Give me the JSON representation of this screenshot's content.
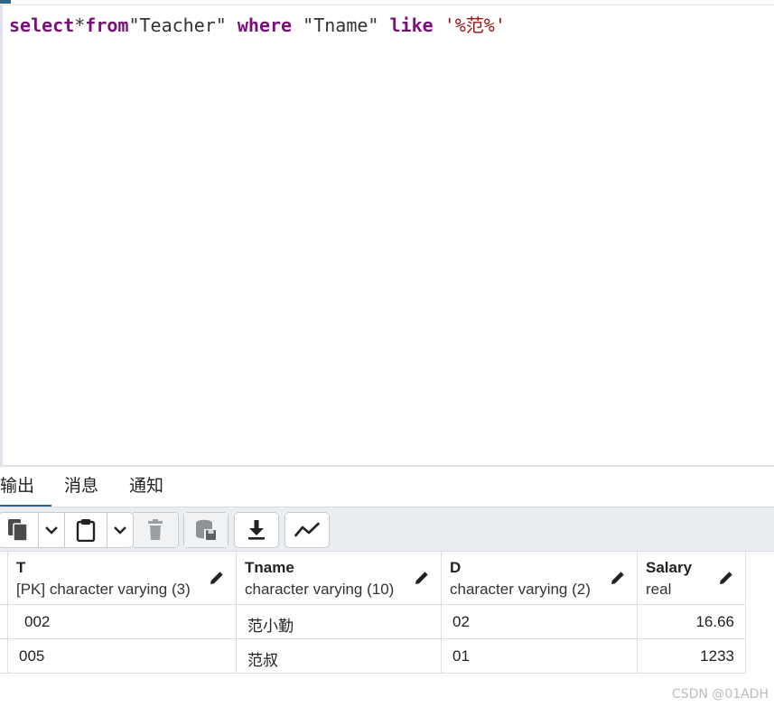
{
  "editor": {
    "query_tokens": [
      {
        "cls": "kw",
        "text": "select"
      },
      {
        "cls": "plain",
        "text": "*"
      },
      {
        "cls": "kw",
        "text": "from"
      },
      {
        "cls": "plain",
        "text": "\"Teacher\" "
      },
      {
        "cls": "kw",
        "text": "where"
      },
      {
        "cls": "plain",
        "text": " \"Tname\" "
      },
      {
        "cls": "kw",
        "text": "like"
      },
      {
        "cls": "plain",
        "text": " "
      },
      {
        "cls": "str",
        "text": "'%范%'"
      }
    ]
  },
  "tabs": {
    "output": "输出",
    "messages": "消息",
    "notifications": "通知"
  },
  "toolbar": {
    "icons": [
      "copy-icon",
      "chevron-down-icon",
      "paste-icon",
      "chevron-down-icon",
      "delete-icon",
      "save-data-icon",
      "download-icon",
      "graph-icon"
    ]
  },
  "grid": {
    "columns": [
      {
        "name": "T",
        "type": "[PK] character varying (3)"
      },
      {
        "name": "Tname",
        "type": "character varying (10)"
      },
      {
        "name": "D",
        "type": "character varying (2)"
      },
      {
        "name": "Salary",
        "type": "real"
      }
    ],
    "rows": [
      [
        "002",
        "范小勤",
        "02",
        "16.66"
      ],
      [
        "005",
        "范叔",
        "01",
        "1233"
      ]
    ]
  },
  "watermark": "CSDN @01ADH",
  "colors": {
    "keyword": "#7a0f7a",
    "string": "#a31515",
    "accent": "#32608f"
  }
}
